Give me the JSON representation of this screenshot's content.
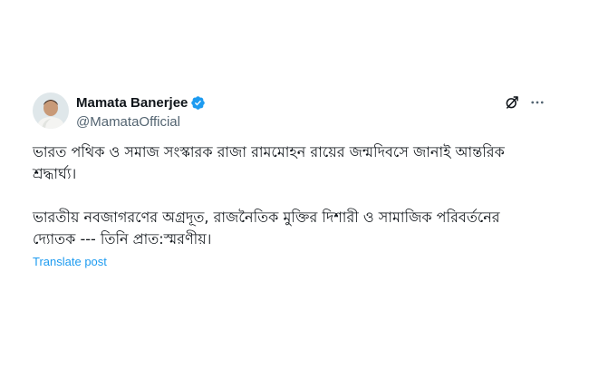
{
  "author": {
    "display_name": "Mamata Banerjee",
    "handle": "@MamataOfficial",
    "verified": true
  },
  "post": {
    "paragraphs": [
      "ভারত পথিক ও সমাজ সংস্কারক রাজা রামমোহন রায়ের জন্মদিবসে জানাই আন্তরিক শ্রদ্ধার্ঘ্য।",
      "ভারতীয় নবজাগরণের অগ্রদূত, রাজনৈতিক মুক্তির দিশারী ও সামাজিক পরিবর্তনের দ্যোতক --- তিনি প্রাত:স্মরণীয়।"
    ],
    "translate_label": "Translate post"
  },
  "icons": {
    "verified": "verified-badge-icon",
    "grok": "grok-icon",
    "more": "more-options-icon"
  },
  "colors": {
    "text": "#0f1419",
    "secondary": "#536471",
    "accent": "#1d9bf0"
  }
}
